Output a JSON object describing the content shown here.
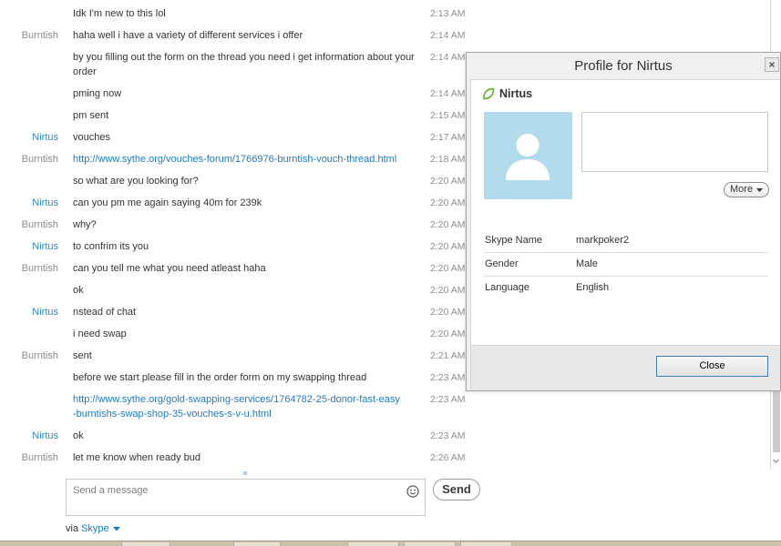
{
  "chat": {
    "sender_colors": {
      "Burntish": "#8c8c8c",
      "Nirtus": "#2b8ccb"
    },
    "messages": [
      {
        "text": "Idk I'm new to this lol",
        "time": "2:13 AM"
      },
      {
        "sender": "Burntish",
        "text": "haha well i have a variety of different services i offer",
        "time": "2:14 AM"
      },
      {
        "text": "by you filling out the form on the thread you need i get information about your order",
        "time": "2:14 AM"
      },
      {
        "text": "pming now",
        "time": "2:14 AM"
      },
      {
        "text": "pm sent",
        "time": "2:15 AM"
      },
      {
        "sender": "Nirtus",
        "text": "vouches",
        "time": "2:17 AM"
      },
      {
        "sender": "Burntish",
        "link": true,
        "text": "http://www.sythe.org/vouches-forum/1766976-burntish-vouch-thread.html",
        "time": "2:18 AM"
      },
      {
        "text": "so what are you looking for?",
        "time": "2:20 AM"
      },
      {
        "sender": "Nirtus",
        "text": "can you pm me again saying 40m for 239k",
        "time": "2:20 AM"
      },
      {
        "sender": "Burntish",
        "text": "why?",
        "time": "2:20 AM"
      },
      {
        "sender": "Nirtus",
        "text": "to confrim its you",
        "time": "2:20 AM"
      },
      {
        "sender": "Burntish",
        "text": "can you tell me what you need atleast haha",
        "time": "2:20 AM"
      },
      {
        "text": "ok",
        "time": "2:20 AM"
      },
      {
        "sender": "Nirtus",
        "text": "nstead of chat",
        "time": "2:20 AM"
      },
      {
        "text": "i need swap",
        "time": "2:20 AM"
      },
      {
        "sender": "Burntish",
        "text": "sent",
        "time": "2:21 AM"
      },
      {
        "text": "before we start please fill in the order form on my swapping thread",
        "time": "2:23 AM"
      },
      {
        "link": true,
        "lines": [
          "http://www.sythe.org/gold-swapping-services/1764782-25-donor-fast-easy",
          "-burntishs-swap-shop-35-vouches-s-v-u.html"
        ],
        "time": "2:23 AM"
      },
      {
        "sender": "Nirtus",
        "text": "ok",
        "time": "2:23 AM"
      },
      {
        "sender": "Burntish",
        "text": "let me know when ready bud",
        "time": "2:26 AM"
      }
    ]
  },
  "composer": {
    "placeholder": "Send a message",
    "emoticon_icon": "smiley-icon",
    "send_label": "Send",
    "via_prefix": "via",
    "via_service": "Skype",
    "via_dropdown_icon": "caret-down-icon"
  },
  "profile_dialog": {
    "title": "Profile for Nirtus",
    "close_icon": "close-icon",
    "status_icon": "contact-leaf-icon",
    "display_name": "Nirtus",
    "avatar_icon": "default-avatar-icon",
    "more_label": "More",
    "more_icon": "caret-down-icon",
    "fields": [
      {
        "label": "Skype Name",
        "value": "markpoker2"
      },
      {
        "label": "Gender",
        "value": "Male"
      },
      {
        "label": "Language",
        "value": "English"
      }
    ],
    "close_label": "Close"
  },
  "colors": {
    "link": "#1f7bc1",
    "timestamp": "#8f8f8f",
    "message_text": "#333333",
    "via_service": "#1f7bc1",
    "avatar_background": "#b2dbec",
    "status_icon": "#5cb82e",
    "focus_border": "#3c7fb1"
  }
}
